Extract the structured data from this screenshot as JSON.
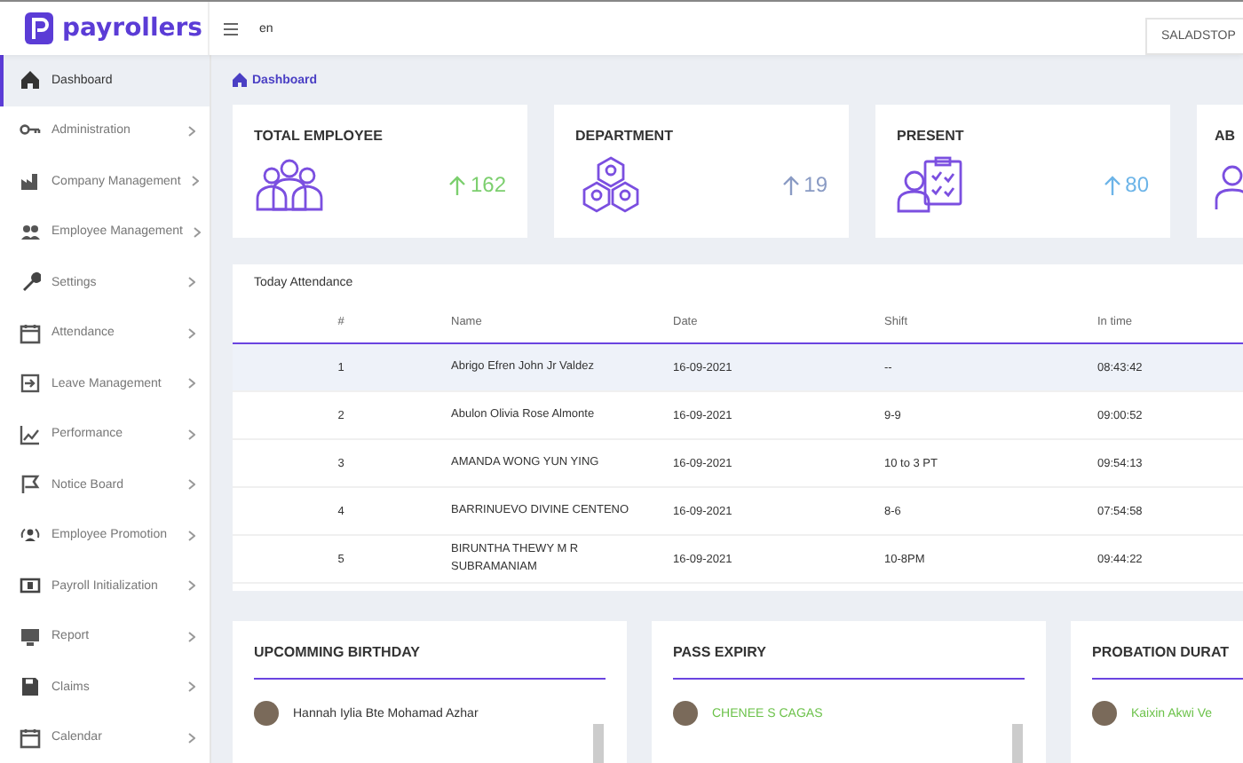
{
  "brand": {
    "name": "payrollers"
  },
  "header": {
    "language": "en",
    "company": "SALADSTOP"
  },
  "sidebar": {
    "items": [
      {
        "label": "Dashboard",
        "selected": true
      },
      {
        "label": "Administration",
        "selected": false
      },
      {
        "label": "Company Management",
        "selected": false
      },
      {
        "label": "Employee Management",
        "selected": false
      },
      {
        "label": "Settings",
        "selected": false
      },
      {
        "label": "Attendance",
        "selected": false
      },
      {
        "label": "Leave Management",
        "selected": false
      },
      {
        "label": "Performance",
        "selected": false
      },
      {
        "label": "Notice Board",
        "selected": false
      },
      {
        "label": "Employee Promotion",
        "selected": false
      },
      {
        "label": "Payroll Initialization",
        "selected": false
      },
      {
        "label": "Report",
        "selected": false
      },
      {
        "label": "Claims",
        "selected": false
      },
      {
        "label": "Calendar",
        "selected": false
      }
    ]
  },
  "breadcrumb": "Dashboard",
  "stats": [
    {
      "title": "TOTAL EMPLOYEE",
      "value": "162",
      "color": "#7ccf6e"
    },
    {
      "title": "DEPARTMENT",
      "value": "19",
      "color": "#8a9bc4"
    },
    {
      "title": "PRESENT",
      "value": "80",
      "color": "#6cb4e8"
    },
    {
      "title": "AB"
    }
  ],
  "attendance": {
    "title": "Today Attendance",
    "columns": [
      "#",
      "Name",
      "Date",
      "Shift",
      "In time"
    ],
    "rows": [
      {
        "cells": [
          "1",
          "Abrigo Efren John Jr Valdez",
          "16-09-2021",
          "--",
          "08:43:42"
        ],
        "selected": true
      },
      {
        "cells": [
          "2",
          "Abulon Olivia Rose Almonte",
          "16-09-2021",
          "9-9",
          "09:00:52"
        ],
        "selected": false
      },
      {
        "cells": [
          "3",
          "AMANDA WONG YUN YING",
          "16-09-2021",
          "10 to 3 PT",
          "09:54:13"
        ],
        "selected": false
      },
      {
        "cells": [
          "4",
          "BARRINUEVO DIVINE CENTENO",
          "16-09-2021",
          "8-6",
          "07:54:58"
        ],
        "selected": false
      },
      {
        "cells": [
          "5",
          "BIRUNTHA THEWY M R SUBRAMANIAM",
          "16-09-2021",
          "10-8PM",
          "09:44:22"
        ],
        "selected": false
      }
    ]
  },
  "panels": [
    {
      "title": "UPCOMMING BIRTHDAY",
      "items": [
        {
          "name": "Hannah Iylia Bte Mohamad Azhar",
          "kind": "plain"
        }
      ]
    },
    {
      "title": "PASS EXPIRY",
      "items": [
        {
          "name": "CHENEE S CAGAS",
          "kind": "highlight"
        }
      ]
    },
    {
      "title": "PROBATION DURAT",
      "items": [
        {
          "name": "Kaixin Akwi Ve",
          "kind": "highlight"
        }
      ]
    }
  ]
}
